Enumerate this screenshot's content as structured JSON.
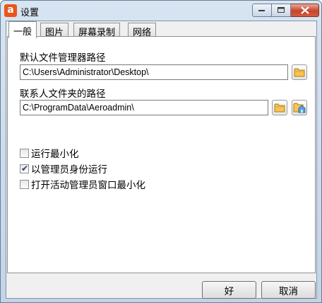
{
  "window": {
    "title": "设置",
    "app_icon_letter": "a"
  },
  "tabs": [
    {
      "label": "一般",
      "active": true
    },
    {
      "label": "图片",
      "active": false
    },
    {
      "label": "屏幕录制",
      "active": false
    },
    {
      "label": "网络",
      "active": false
    }
  ],
  "general": {
    "file_manager_label": "默认文件管理器路径",
    "file_manager_path": "C:\\Users\\Administrator\\Desktop\\",
    "contacts_label": "联系人文件夹的路径",
    "contacts_path": "C:\\ProgramData\\Aeroadmin\\",
    "options": [
      {
        "label": "运行最小化",
        "checked": false
      },
      {
        "label": "以管理员身份运行",
        "checked": true
      },
      {
        "label": "打开活动管理员窗口最小化",
        "checked": false
      }
    ]
  },
  "buttons": {
    "ok": "好",
    "cancel": "取消"
  },
  "colors": {
    "app_icon": "#e8561b",
    "close_button": "#c7442b",
    "folder": "#f0b43a"
  },
  "icons": {
    "app": "aeroadmin-logo-icon",
    "folder": "folder-icon",
    "folder_home": "folder-home-icon"
  }
}
